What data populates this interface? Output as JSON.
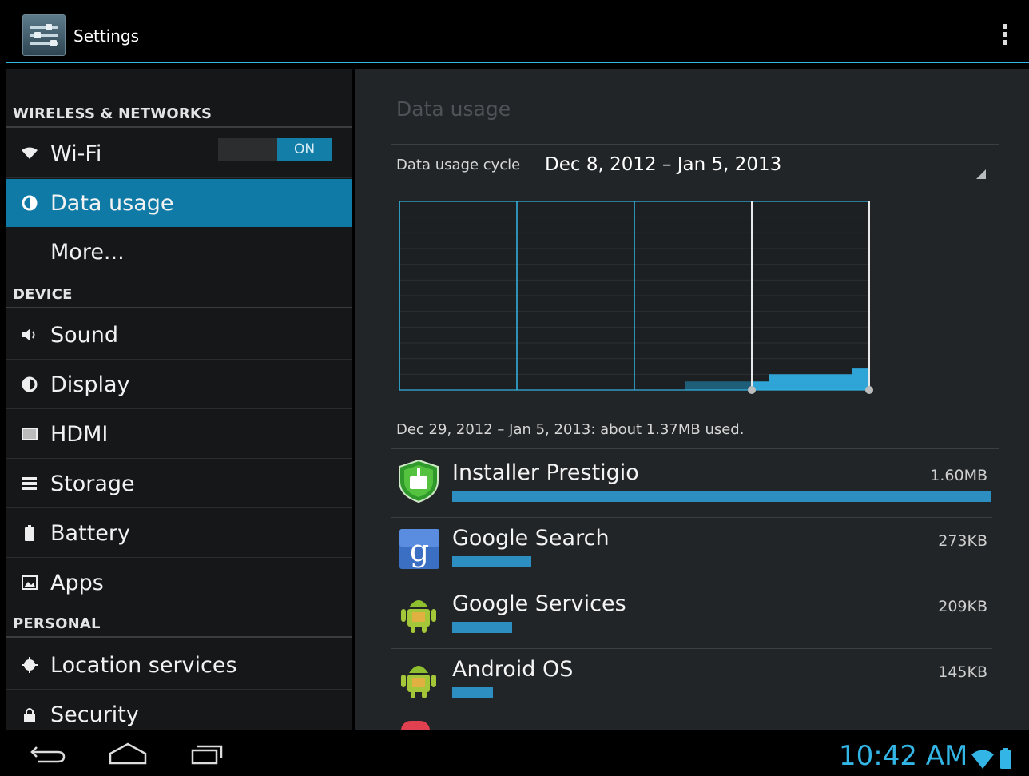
{
  "action_bar": {
    "title": "Settings",
    "icon": "settings-sliders-icon",
    "overflow_icon": "overflow-menu-icon",
    "accent_color": "#33b5e5"
  },
  "sidebar": {
    "sections": [
      {
        "header": "WIRELESS & NETWORKS"
      },
      {
        "header": "DEVICE"
      },
      {
        "header": "PERSONAL"
      }
    ],
    "items": [
      {
        "label": "Wi-Fi",
        "icon": "wifi-icon",
        "toggle": "ON"
      },
      {
        "label": "Data usage",
        "icon": "data-usage-icon",
        "selected": true
      },
      {
        "label": "More...",
        "icon": ""
      },
      {
        "label": "Sound",
        "icon": "speaker-icon"
      },
      {
        "label": "Display",
        "icon": "brightness-icon"
      },
      {
        "label": "HDMI",
        "icon": "hdmi-icon"
      },
      {
        "label": "Storage",
        "icon": "storage-icon"
      },
      {
        "label": "Battery",
        "icon": "battery-icon"
      },
      {
        "label": "Apps",
        "icon": "apps-icon"
      },
      {
        "label": "Location services",
        "icon": "location-icon"
      },
      {
        "label": "Security",
        "icon": "lock-icon"
      }
    ],
    "selected_color": "#0f7aa6"
  },
  "main": {
    "title": "Data usage",
    "cycle_label": "Data usage cycle",
    "cycle_value": "Dec 8, 2012 – Jan 5, 2013",
    "summary": "Dec 29, 2012 – Jan 5, 2013: about 1.37MB used.",
    "apps": [
      {
        "name": "Installer Prestigio",
        "size": "1.60MB",
        "fraction": 1.0,
        "icon": "installer-prestigio-icon"
      },
      {
        "name": "Google Search",
        "size": "273KB",
        "fraction": 0.147,
        "icon": "google-search-icon"
      },
      {
        "name": "Google Services",
        "size": "209KB",
        "fraction": 0.112,
        "icon": "android-icon"
      },
      {
        "name": "Android OS",
        "size": "145KB",
        "fraction": 0.075,
        "icon": "android-icon"
      }
    ],
    "bar_color": "#2d8fc1"
  },
  "chart_data": {
    "type": "area",
    "title": "",
    "xlabel": "",
    "ylabel": "",
    "grid": true,
    "cycle_days": 28,
    "week_markers": 4,
    "selection_start_day": 21,
    "selection_end_day": 28,
    "series": [
      {
        "values": [
          0,
          0,
          0,
          0,
          0,
          0,
          0,
          0,
          0,
          0,
          0,
          0,
          0,
          0,
          0,
          0,
          0,
          0.55,
          0.55,
          0.55,
          0.55,
          0.55,
          1.0,
          1.0,
          1.0,
          1.0,
          1.0,
          1.37
        ]
      }
    ]
  },
  "navbar": {
    "back_icon": "back-icon",
    "home_icon": "home-icon",
    "recents_icon": "recent-apps-icon",
    "clock": "10:42 AM",
    "wifi_icon": "wifi-status-icon",
    "battery_icon": "battery-status-icon"
  }
}
